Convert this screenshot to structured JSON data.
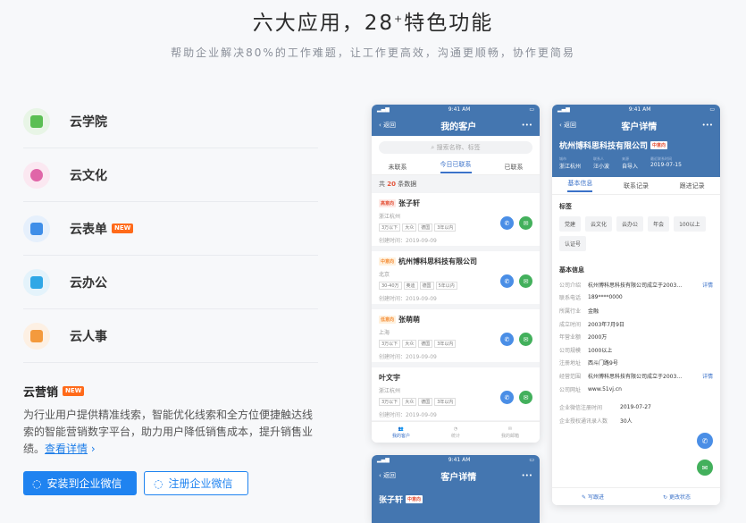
{
  "hero": {
    "title": "六大应用，28",
    "sup": "+",
    "title_tail": "特色功能",
    "subtitle": "帮助企业解决80%的工作难题，让工作更高效，沟通更顺畅，协作更简易"
  },
  "features": [
    {
      "label": "云学院",
      "icon": "book-icon",
      "color": "#5bbf54",
      "bg": "#e8f5e6",
      "new": ""
    },
    {
      "label": "云文化",
      "icon": "flower-icon",
      "color": "#e066a8",
      "bg": "#fbe8f1",
      "new": ""
    },
    {
      "label": "云表单",
      "icon": "form-icon",
      "color": "#3f8ee8",
      "bg": "#e6f0fc",
      "new": "NEW"
    },
    {
      "label": "云办公",
      "icon": "briefcase-icon",
      "color": "#2fa7e6",
      "bg": "#e4f3fb",
      "new": ""
    },
    {
      "label": "云人事",
      "icon": "id-card-icon",
      "color": "#f49a3d",
      "bg": "#fdf0e3",
      "new": ""
    }
  ],
  "yingxiao": {
    "title": "云营销",
    "badge": "NEW",
    "desc": "为行业用户提供精准线索，智能优化线索和全方位便捷触达线索的智能营销数字平台，助力用户降低销售成本，提升销售业绩。",
    "link": "查看详情",
    "link_arrow": "›"
  },
  "buttons": {
    "install": "安装到企业微信",
    "register": "注册企业微信"
  },
  "phone1": {
    "time": "9:41 AM",
    "back": "返回",
    "title": "我的客户",
    "more": "•••",
    "search": "搜索名称、标签",
    "tabs": [
      "未联系",
      "今日已联系",
      "已联系"
    ],
    "count_pre": "共",
    "count": "20",
    "count_post": "条数据",
    "cards": [
      {
        "tag": "高意向",
        "tagc": "red",
        "name": "张子轩",
        "loc": "浙江杭州",
        "chips": [
          "3万以下",
          "大众",
          "德国",
          "3年以内"
        ],
        "date": "创建时间：2019-09-09"
      },
      {
        "tag": "中意向",
        "tagc": "org",
        "name": "杭州博科思科技有限公司",
        "loc": "北京",
        "chips": [
          "30-40万",
          "奥迪",
          "德国",
          "5年以内"
        ],
        "date": "创建时间：2019-09-09"
      },
      {
        "tag": "低意向",
        "tagc": "org",
        "name": "张萌萌",
        "loc": "上海",
        "chips": [
          "3万以下",
          "大众",
          "德国",
          "3年以内"
        ],
        "date": "创建时间：2019-09-09"
      },
      {
        "tag": "",
        "tagc": "",
        "name": "叶文宇",
        "loc": "浙江杭州",
        "chips": [
          "3万以下",
          "大众",
          "德国",
          "3年以内"
        ],
        "date": "创建时间：2019-09-09"
      }
    ],
    "tabbar": [
      "我的客户",
      "统计",
      "我的邮箱"
    ]
  },
  "phone2": {
    "time": "9:41 AM",
    "back": "返回",
    "title": "客户详情",
    "more": "•••",
    "company": "杭州博科思科技有限公司",
    "tag": "中意向",
    "meta": [
      {
        "k": "城市",
        "v": "浙江杭州"
      },
      {
        "k": "联系人",
        "v": "汪小波"
      },
      {
        "k": "来源",
        "v": "自导入"
      },
      {
        "k": "最近联系时间",
        "v": "2019-07-15"
      }
    ],
    "tabs": [
      "基本信息",
      "联系记录",
      "跟进记录"
    ],
    "label_title": "标签",
    "labels": [
      "党建",
      "云文化",
      "云办公",
      "年会",
      "100以上",
      "认证号"
    ],
    "info_title": "基本信息",
    "rows": [
      {
        "k": "公司介绍",
        "v": "杭州博科思科技有限公司成立于2003…",
        "link": "详情"
      },
      {
        "k": "联系电话",
        "v": "189****0000",
        "link": ""
      },
      {
        "k": "所属行业",
        "v": "金融",
        "link": ""
      },
      {
        "k": "成立时间",
        "v": "2003年7月9日",
        "link": ""
      },
      {
        "k": "年营业额",
        "v": "2000万",
        "link": ""
      },
      {
        "k": "公司规模",
        "v": "1000以上",
        "link": ""
      },
      {
        "k": "注册地址",
        "v": "西斗门路9号",
        "link": ""
      },
      {
        "k": "经营范围",
        "v": "杭州博科思科技有限公司成立于2003…",
        "link": "详情"
      },
      {
        "k": "公司网址",
        "v": "www.51vj.cn",
        "link": ""
      },
      {
        "k": "企业微信注册时间",
        "v": "2019-07-27",
        "link": ""
      },
      {
        "k": "企业授权通讯录人数",
        "v": "30人",
        "link": ""
      }
    ],
    "foot": [
      "写跟进",
      "更改状态"
    ]
  },
  "phone3": {
    "time": "9:41 AM",
    "back": "返回",
    "title": "客户详情",
    "more": "•••",
    "name": "张子轩",
    "tag": "中意向"
  }
}
